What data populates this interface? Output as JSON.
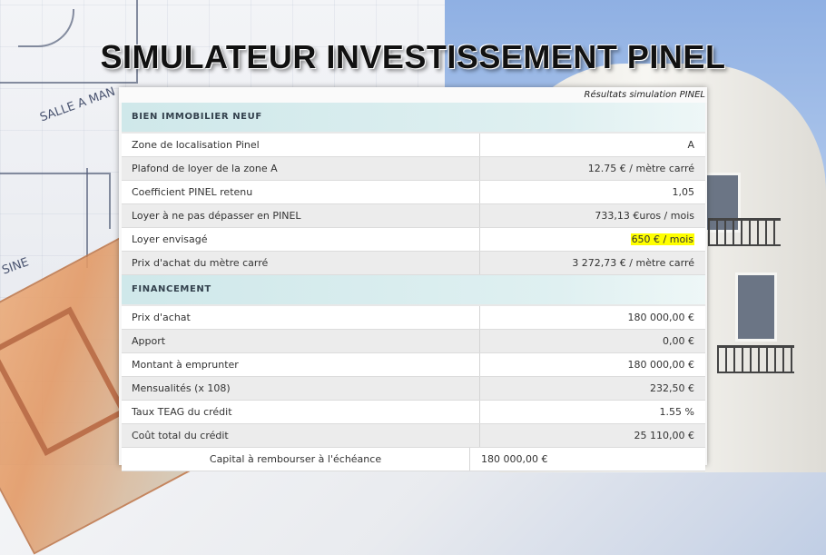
{
  "title": "SIMULATEUR INVESTISSEMENT PINEL",
  "panel_header": "Résultats simulation PINEL",
  "background_labels": {
    "plan_room_1": "SALLE A MAN",
    "plan_room_2": "SINE"
  },
  "sections": {
    "bien": {
      "title": "BIEN IMMOBILIER NEUF",
      "rows": [
        {
          "label": "Zone de localisation Pinel",
          "value": "A"
        },
        {
          "label": "Plafond de loyer de la zone A",
          "value": "12.75 € / mètre carré"
        },
        {
          "label": "Coefficient PINEL retenu",
          "value": "1,05"
        },
        {
          "label": "Loyer à ne pas dépasser en PINEL",
          "value": "733,13 €uros / mois"
        },
        {
          "label": "Loyer envisagé",
          "value": "650 € / mois"
        },
        {
          "label": "Prix d'achat du mètre carré",
          "value": "3 272,73 € / mètre carré"
        }
      ]
    },
    "financement": {
      "title": "FINANCEMENT",
      "rows": [
        {
          "label": "Prix d'achat",
          "value": "180 000,00 €"
        },
        {
          "label": "Apport",
          "value": "0,00 €"
        },
        {
          "label": "Montant à emprunter",
          "value": "180 000,00 €"
        },
        {
          "label": "Mensualités (x 108)",
          "value": "232,50 €"
        },
        {
          "label": "Taux TEAG du crédit",
          "value": "1.55 %"
        },
        {
          "label": "Coût total du crédit",
          "value": "25 110,00 €"
        },
        {
          "label": "Capital à rembourser à l'échéance",
          "value": "180 000,00 €"
        }
      ]
    }
  },
  "colors": {
    "highlight": "#ffff00",
    "section_bg": "#cfe8ea"
  }
}
